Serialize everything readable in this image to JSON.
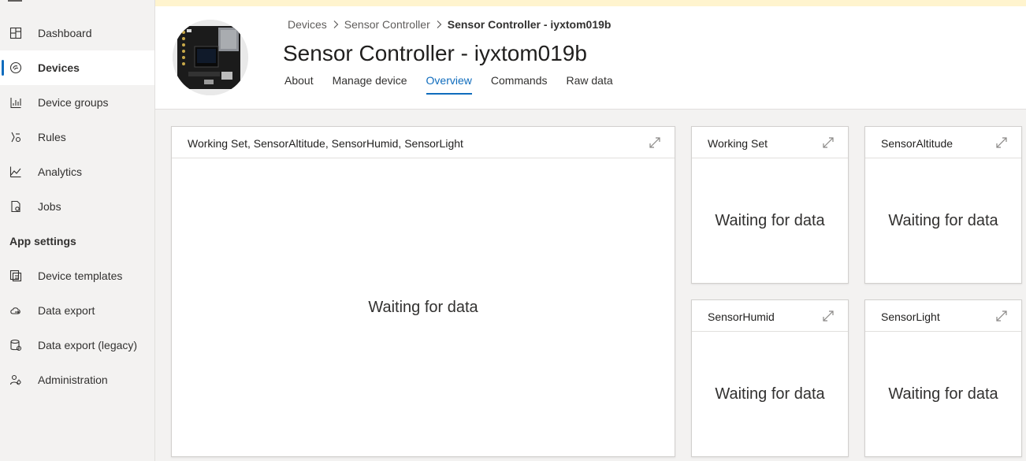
{
  "sidebar": {
    "items": [
      {
        "label": "Dashboard",
        "icon": "dashboard-icon"
      },
      {
        "label": "Devices",
        "icon": "devices-icon",
        "active": true
      },
      {
        "label": "Device groups",
        "icon": "device-groups-icon"
      },
      {
        "label": "Rules",
        "icon": "rules-icon"
      },
      {
        "label": "Analytics",
        "icon": "analytics-icon"
      },
      {
        "label": "Jobs",
        "icon": "jobs-icon"
      }
    ],
    "section_title": "App settings",
    "settings_items": [
      {
        "label": "Device templates",
        "icon": "device-templates-icon"
      },
      {
        "label": "Data export",
        "icon": "data-export-icon"
      },
      {
        "label": "Data export (legacy)",
        "icon": "data-export-legacy-icon"
      },
      {
        "label": "Administration",
        "icon": "administration-icon"
      }
    ]
  },
  "breadcrumb": {
    "items": [
      "Devices",
      "Sensor Controller"
    ],
    "current": "Sensor Controller - iyxtom019b"
  },
  "header": {
    "title": "Sensor Controller - iyxtom019b"
  },
  "tabs": [
    {
      "label": "About"
    },
    {
      "label": "Manage device"
    },
    {
      "label": "Overview",
      "active": true
    },
    {
      "label": "Commands"
    },
    {
      "label": "Raw data"
    }
  ],
  "tiles": [
    {
      "title": "Working Set, SensorAltitude, SensorHumid, SensorLight",
      "status": "Waiting for data"
    },
    {
      "title": "Working Set",
      "status": "Waiting for data"
    },
    {
      "title": "SensorAltitude",
      "status": "Waiting for data"
    },
    {
      "title": "SensorHumid",
      "status": "Waiting for data"
    },
    {
      "title": "SensorLight",
      "status": "Waiting for data"
    }
  ],
  "colors": {
    "accent": "#0f6cbd",
    "banner": "#fff4ce",
    "sidebar_bg": "#f3f2f1"
  }
}
